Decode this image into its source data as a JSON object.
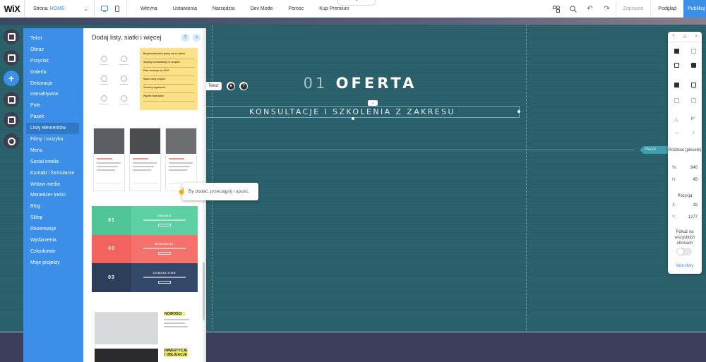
{
  "topbar": {
    "logo": "WiX",
    "site_label": "Strona",
    "page_name": "HOME",
    "menu": [
      "Witryna",
      "Ustawienia",
      "Narzędzia",
      "Dev Mode",
      "Pomoc",
      "Kup Premium"
    ],
    "saved": "Zapisano",
    "preview": "Podgląd",
    "publish": "Publikuj"
  },
  "categories": [
    "Tekst",
    "Obraz",
    "Przycisk",
    "Galeria",
    "Dekoracje",
    "Interaktywne",
    "Pole",
    "Pasek",
    "Listy elementów",
    "Filmy i muzyka",
    "Menu",
    "Social media",
    "Kontakt i formularze",
    "Wstaw media",
    "Menedżer treści",
    "Blog",
    "Sklep",
    "Rezerwacje",
    "Wydarzenia",
    "Członkowie",
    "Moje projekty"
  ],
  "selected_category": "Listy elementów",
  "panel": {
    "title": "Dodaj listy, siatki i więcej",
    "help": "?",
    "close": "×"
  },
  "thumb1_rows": [
    "Bezpieczeństwo pracy na co dzień",
    "Zasady komunikacji w zespole",
    "Plan rozwoju na 2019",
    "Nasz nowy zespół",
    "Terminy wydarzeń",
    "Wyniki kwartalne"
  ],
  "thumb3_rows": [
    {
      "num": "01",
      "head": "DESIGN",
      "color": "#4fc497"
    },
    {
      "num": "03",
      "head": "BRANDING",
      "color": "#f2625f"
    },
    {
      "num": "03",
      "head": "CONSULTING",
      "color": "#2d3e5a"
    }
  ],
  "thumb4": {
    "tag1": "NOWOŚCI",
    "tag2": "INWESTYCJE I OBLIGACJE"
  },
  "tooltip": "By dodać, przeciągnij i upuść.",
  "canvas": {
    "title_num": "01",
    "title": "OFERTA",
    "subtitle": "KONSULTACJE I SZKOLENIA Z ZAKRESU",
    "chip": "Tekst",
    "strip_tag": "PASEK"
  },
  "inspector": {
    "help": "?",
    "angle": "0°",
    "size_label": "Rozmiar (piksele)",
    "w_label": "W:",
    "w_value": "940",
    "h_label": "H:",
    "h_value": "45",
    "pos_label": "Pozycja",
    "x_label": "X:",
    "x_value": "19",
    "y_label": "Y:",
    "y_value": "1277",
    "show_all": "Pokaż na wszystkich stronach",
    "layers": "Warstwy"
  }
}
